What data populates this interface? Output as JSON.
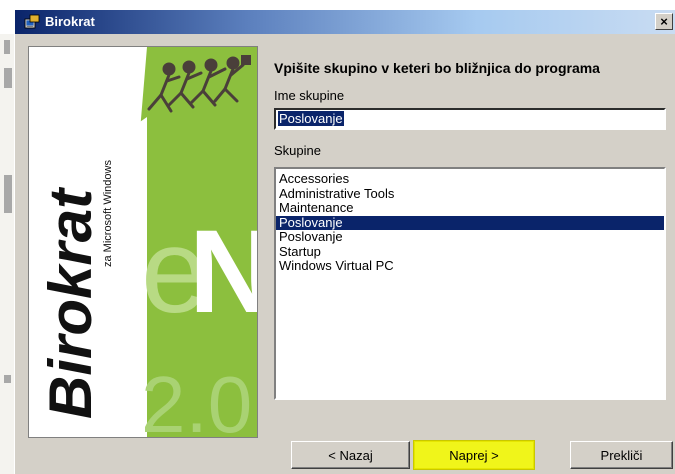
{
  "window": {
    "title": "Birokrat",
    "close_label": "×"
  },
  "banner": {
    "brand": "Birokrat",
    "subtitle": "za Microsoft Windows",
    "big_letter_e": "e",
    "big_letter_n": "N",
    "version": "2.0",
    "colors": {
      "green": "#8cbf3e",
      "brand_black": "#111111"
    }
  },
  "form": {
    "heading": "Vpišite skupino v keteri bo bližnjica do programa",
    "name_label": "Ime skupine",
    "name_value": "Poslovanje",
    "groups_label": "Skupine",
    "groups": [
      {
        "label": "Accessories",
        "selected": false
      },
      {
        "label": "Administrative Tools",
        "selected": false
      },
      {
        "label": "Maintenance",
        "selected": false
      },
      {
        "label": "Poslovanje",
        "selected": true
      },
      {
        "label": "Poslovanje",
        "selected": false
      },
      {
        "label": "Startup",
        "selected": false
      },
      {
        "label": "Windows Virtual PC",
        "selected": false
      }
    ]
  },
  "buttons": {
    "back": "< Nazaj",
    "next": "Naprej >",
    "cancel": "Prekliči"
  }
}
